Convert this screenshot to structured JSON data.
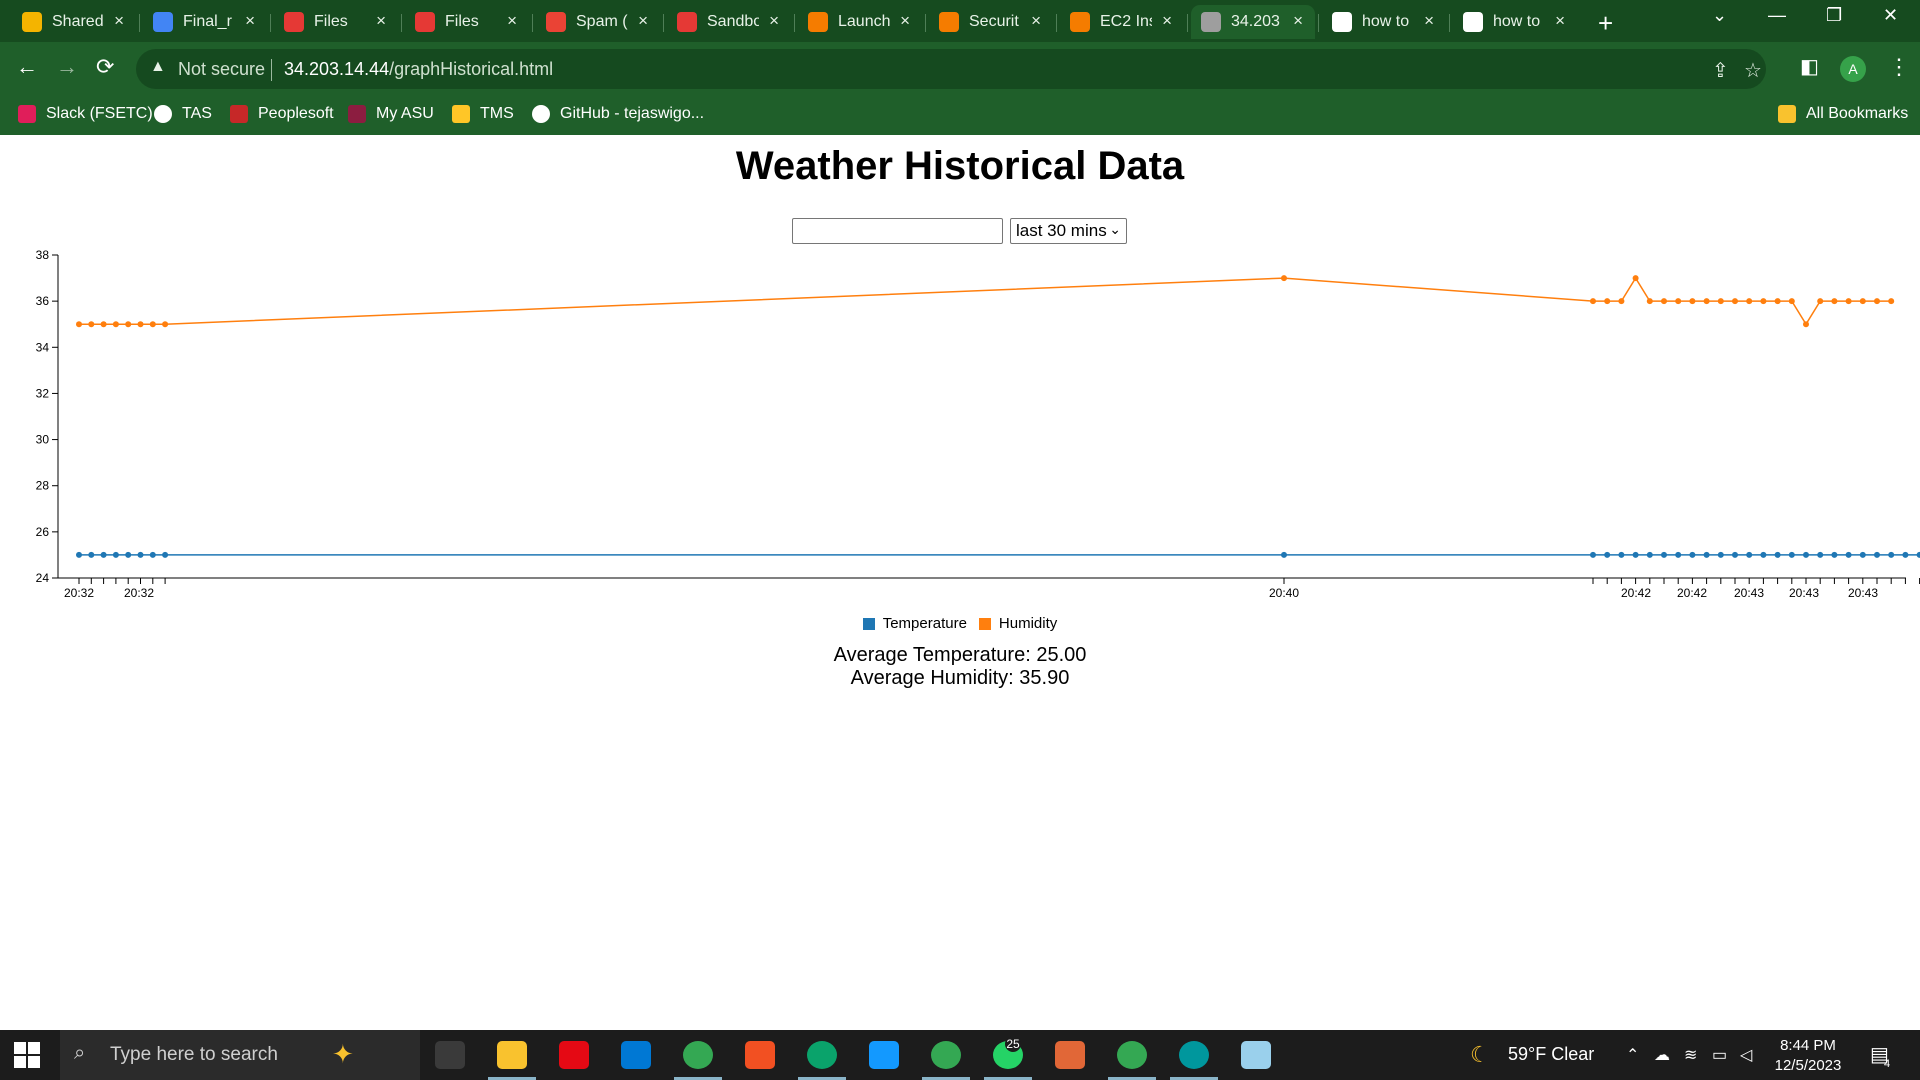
{
  "browser": {
    "tabs": [
      {
        "label": "Shared",
        "color": "#f4b400"
      },
      {
        "label": "Final_r",
        "color": "#4285f4"
      },
      {
        "label": "Files",
        "color": "#e53935"
      },
      {
        "label": "Files",
        "color": "#e53935"
      },
      {
        "label": "Spam (",
        "color": "#ea4335"
      },
      {
        "label": "Sandbo",
        "color": "#e53935"
      },
      {
        "label": "Launch",
        "color": "#f57c00"
      },
      {
        "label": "Securit",
        "color": "#f57c00"
      },
      {
        "label": "EC2 Ins",
        "color": "#f57c00"
      },
      {
        "label": "34.203",
        "color": "#9e9e9e"
      },
      {
        "label": "how to",
        "color": "#ffffff"
      },
      {
        "label": "how to",
        "color": "#ffffff"
      }
    ],
    "active_tab_index": 9,
    "address": {
      "security_label": "Not secure",
      "host": "34.203.14.44",
      "path": "/graphHistorical.html"
    },
    "profile_initial": "A",
    "bookmarks": [
      {
        "label": "Slack (FSETC)",
        "color": "#e01e5a"
      },
      {
        "label": "TAS",
        "color": "#ffffff"
      },
      {
        "label": "Peoplesoft",
        "color": "#c62828"
      },
      {
        "label": "My ASU",
        "color": "#8c1d40"
      },
      {
        "label": "TMS",
        "color": "#ffc627"
      },
      {
        "label": "GitHub - tejaswigo...",
        "color": "#ffffff"
      }
    ],
    "all_bookmarks_label": "All Bookmarks"
  },
  "page": {
    "title": "Weather Historical Data",
    "date_input_value": "",
    "range_select_value": "last 30 mins",
    "avg_temperature_text": "Average Temperature: 25.00",
    "avg_humidity_text": "Average Humidity: 35.90"
  },
  "chart_data": {
    "type": "line",
    "ylim": [
      24,
      38
    ],
    "yticks": [
      24,
      26,
      28,
      30,
      32,
      34,
      36,
      38
    ],
    "x_tick_labels": [
      "20:32",
      "20:32",
      "20:40",
      "20:42",
      "20:42",
      "20:43",
      "20:43",
      "20:43"
    ],
    "series": [
      {
        "name": "Temperature",
        "color": "#1f77b4",
        "values": [
          25,
          25,
          25,
          25,
          25,
          25,
          25,
          25,
          25,
          25,
          25,
          25,
          25,
          25,
          25,
          25,
          25,
          25,
          25,
          25,
          25,
          25,
          25,
          25,
          25,
          25,
          25,
          25,
          25,
          25,
          25,
          25,
          25,
          25,
          25,
          25,
          25
        ]
      },
      {
        "name": "Humidity",
        "color": "#ff7f0e",
        "values": [
          35,
          35,
          35,
          35,
          35,
          35,
          35,
          35,
          37,
          36,
          36,
          36,
          37,
          36,
          36,
          36,
          36,
          36,
          36,
          36,
          36,
          36,
          36,
          36,
          35,
          36,
          36,
          36,
          36,
          36,
          36
        ]
      }
    ]
  },
  "taskbar": {
    "search_placeholder": "Type here to search",
    "apps": [
      {
        "name": "task-view",
        "color": "#3a3a3a"
      },
      {
        "name": "file-explorer",
        "color": "#f9c22e"
      },
      {
        "name": "netflix",
        "color": "#e50914"
      },
      {
        "name": "mail",
        "color": "#0078d4"
      },
      {
        "name": "chrome",
        "color": "#34a853"
      },
      {
        "name": "microsoft-store",
        "color": "#f25022"
      },
      {
        "name": "edge",
        "color": "#0aa36b"
      },
      {
        "name": "prime-video",
        "color": "#1399ff"
      },
      {
        "name": "chrome",
        "color": "#34a853"
      },
      {
        "name": "whatsapp",
        "color": "#25d366"
      },
      {
        "name": "matlab",
        "color": "#e16737"
      },
      {
        "name": "chrome",
        "color": "#34a853"
      },
      {
        "name": "arduino",
        "color": "#00979d"
      },
      {
        "name": "notes",
        "color": "#9ad0ec"
      }
    ],
    "whatsapp_badge": "25",
    "weather_text": "59°F  Clear",
    "time": "8:44 PM",
    "date": "12/5/2023",
    "notification_count": "4"
  }
}
